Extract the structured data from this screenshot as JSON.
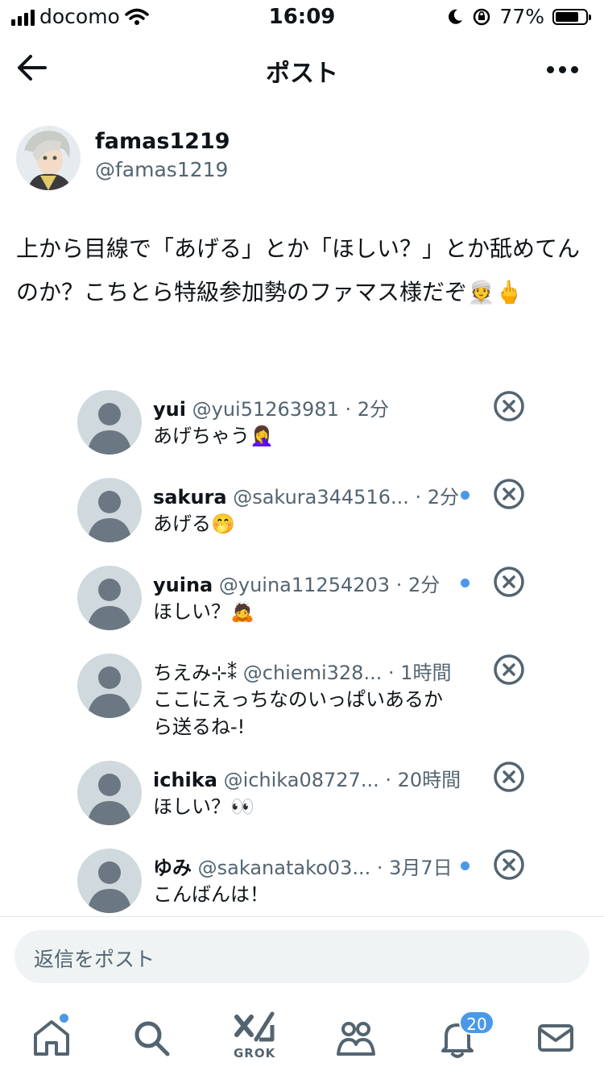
{
  "status_bar": {
    "carrier": "docomo",
    "time": "16:09",
    "battery": "77%",
    "battery_level": 0.77
  },
  "header": {
    "title": "ポスト"
  },
  "post": {
    "author_name": "famas1219",
    "author_handle": "@famas1219",
    "text": "上から目線で「あげる」とか「ほしい？」とか舐めてんのか？こちとら特級参加勢のファマス様だぞ👳🖕"
  },
  "replies": [
    {
      "name": "yui",
      "handle": "@yui51263981",
      "time": "· 2分",
      "text": "あげちゃう🤦‍♀️"
    },
    {
      "name": "sakura",
      "handle": "@sakura344516...",
      "time": "· 2分",
      "text": "あげる🤭"
    },
    {
      "name": "yuina",
      "handle": "@yuina11254203",
      "time": "· 2分",
      "text": "ほしい？🙇"
    },
    {
      "name": "ちえみ⊹⁑",
      "handle": "@chiemi328...",
      "time": "· 1時間",
      "text": "ここにえっちなのいっぱいあるから送るね-!"
    },
    {
      "name": "ichika",
      "handle": "@ichika08727...",
      "time": "· 20時間",
      "text": "ほしい？👀"
    },
    {
      "name": "ゆみ",
      "handle": "@sakanatako03...",
      "time": "· 3月7日",
      "text": "こんばんは！"
    }
  ],
  "reply_input": {
    "placeholder": "返信をポスト"
  },
  "tabbar": {
    "grok_label": "GROK",
    "notifications_badge": "20"
  },
  "colors": {
    "accent": "#4a99e9",
    "text": "#0f1419",
    "secondary": "#536471"
  },
  "icons": [
    "back-arrow-icon",
    "more-icon",
    "close-circle-icon",
    "home-icon",
    "search-icon",
    "grok-icon",
    "communities-icon",
    "notifications-icon",
    "messages-icon"
  ]
}
